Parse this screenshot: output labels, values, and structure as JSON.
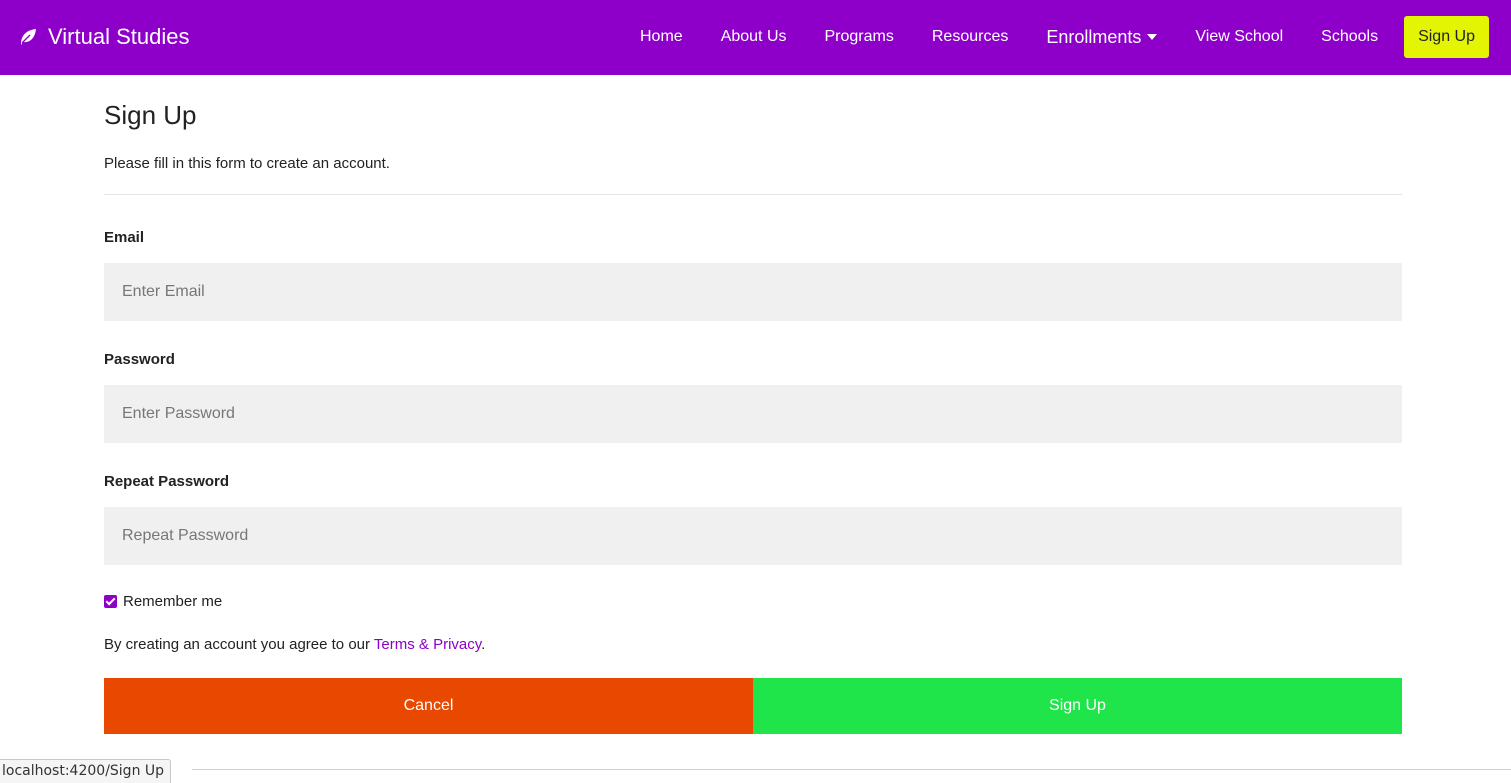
{
  "brand": {
    "name": "Virtual Studies",
    "icon": "leaf-icon"
  },
  "nav": {
    "items": [
      {
        "label": "Home"
      },
      {
        "label": "About Us"
      },
      {
        "label": "Programs"
      },
      {
        "label": "Resources"
      },
      {
        "label": "Enrollments"
      },
      {
        "label": "View School"
      },
      {
        "label": "Schools"
      }
    ],
    "signup_label": "Sign Up"
  },
  "form": {
    "title": "Sign Up",
    "subtitle": "Please fill in this form to create an account.",
    "email": {
      "label": "Email",
      "placeholder": "Enter Email",
      "value": ""
    },
    "password": {
      "label": "Password",
      "placeholder": "Enter Password",
      "value": ""
    },
    "repeat_password": {
      "label": "Repeat Password",
      "placeholder": "Repeat Password",
      "value": ""
    },
    "remember": {
      "label": "Remember me",
      "checked": true
    },
    "terms_prefix": "By creating an account you agree to our ",
    "terms_link": "Terms & Privacy",
    "terms_suffix": ".",
    "cancel_label": "Cancel",
    "submit_label": "Sign Up"
  },
  "status_bar": {
    "url": "localhost:4200/Sign Up"
  },
  "colors": {
    "navbar": "#8e00c9",
    "nav_signup": "#e4f504",
    "cancel": "#e84800",
    "submit": "#1fe54a",
    "field_bg": "#f0f0f0"
  }
}
